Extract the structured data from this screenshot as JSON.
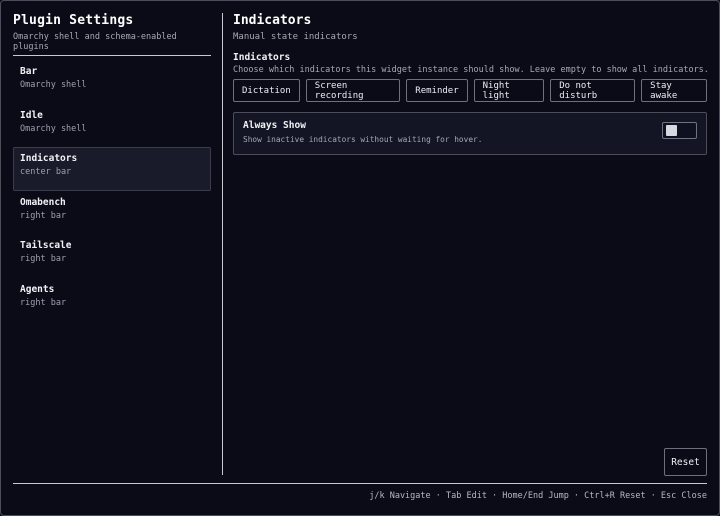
{
  "sidebar": {
    "title": "Plugin Settings",
    "subtitle": "Omarchy shell and schema-enabled plugins",
    "items": [
      {
        "name": "Bar",
        "meta": "Omarchy shell"
      },
      {
        "name": "Idle",
        "meta": "Omarchy shell"
      },
      {
        "name": "Indicators",
        "meta": "center bar",
        "active": true
      },
      {
        "name": "Omabench",
        "meta": "right bar"
      },
      {
        "name": "Tailscale",
        "meta": "right bar"
      },
      {
        "name": "Agents",
        "meta": "right bar"
      }
    ]
  },
  "main": {
    "title": "Indicators",
    "subtitle": "Manual state indicators",
    "field": {
      "label": "Indicators",
      "help": "Choose which indicators this widget instance should show. Leave empty to show all indicators.",
      "options": [
        "Dictation",
        "Screen recording",
        "Reminder",
        "Night light",
        "Do not disturb",
        "Stay awake"
      ]
    },
    "toggle": {
      "title": "Always Show",
      "help": "Show inactive indicators without waiting for hover.",
      "value": false
    },
    "reset_label": "Reset"
  },
  "footer": {
    "hints": "j/k Navigate · Tab Edit · Home/End Jump · Ctrl+R Reset · Esc Close"
  },
  "colors": {
    "background": "#0b0b17",
    "active_item": "#191b2a",
    "text": "#e4e6ee",
    "muted": "#a5a8b6"
  }
}
